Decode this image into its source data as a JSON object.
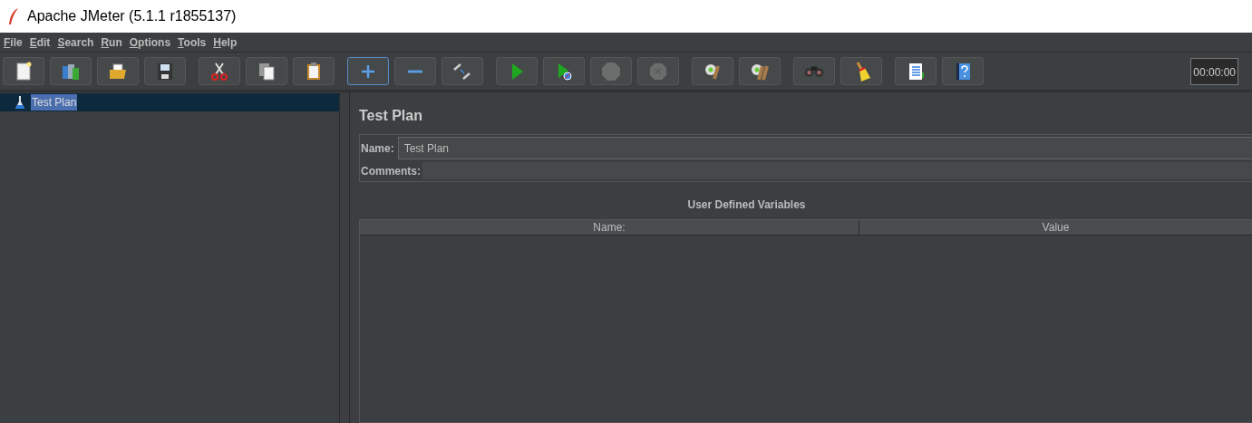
{
  "window": {
    "title": "Apache JMeter (5.1.1 r1855137)"
  },
  "menu": [
    {
      "label": "File"
    },
    {
      "label": "Edit"
    },
    {
      "label": "Search"
    },
    {
      "label": "Run"
    },
    {
      "label": "Options"
    },
    {
      "label": "Tools"
    },
    {
      "label": "Help"
    }
  ],
  "toolbar": [
    [
      {
        "kind": "new",
        "disabled": false,
        "focused": false
      },
      {
        "kind": "templates",
        "disabled": false,
        "focused": false
      },
      {
        "kind": "open",
        "disabled": false,
        "focused": false
      },
      {
        "kind": "save",
        "disabled": false,
        "focused": false
      }
    ],
    [
      {
        "kind": "cut",
        "disabled": false,
        "focused": false
      },
      {
        "kind": "copy",
        "disabled": false,
        "focused": false
      },
      {
        "kind": "paste",
        "disabled": false,
        "focused": false
      }
    ],
    [
      {
        "kind": "expand",
        "disabled": false,
        "focused": true
      },
      {
        "kind": "collapse",
        "disabled": false,
        "focused": false
      },
      {
        "kind": "toggle",
        "disabled": false,
        "focused": false
      }
    ],
    [
      {
        "kind": "start",
        "disabled": false,
        "focused": false
      },
      {
        "kind": "start_no_pause",
        "disabled": false,
        "focused": false
      },
      {
        "kind": "stop",
        "disabled": true,
        "focused": false
      },
      {
        "kind": "shutdown",
        "disabled": true,
        "focused": false
      }
    ],
    [
      {
        "kind": "clear",
        "disabled": false,
        "focused": false
      },
      {
        "kind": "clear_all",
        "disabled": false,
        "focused": false
      }
    ],
    [
      {
        "kind": "search",
        "disabled": false,
        "focused": false
      },
      {
        "kind": "reset_search",
        "disabled": false,
        "focused": false
      }
    ],
    [
      {
        "kind": "functions",
        "disabled": false,
        "focused": false
      },
      {
        "kind": "help",
        "disabled": false,
        "focused": false
      }
    ]
  ],
  "timer": "00:00:00",
  "tree": [
    {
      "label": "Test Plan",
      "selected": true
    }
  ],
  "panel": {
    "title": "Test Plan",
    "name_label": "Name:",
    "name_value": "Test Plan",
    "comments_label": "Comments:",
    "table": {
      "title": "User Defined Variables",
      "columns": [
        "Name:",
        "Value"
      ]
    }
  }
}
